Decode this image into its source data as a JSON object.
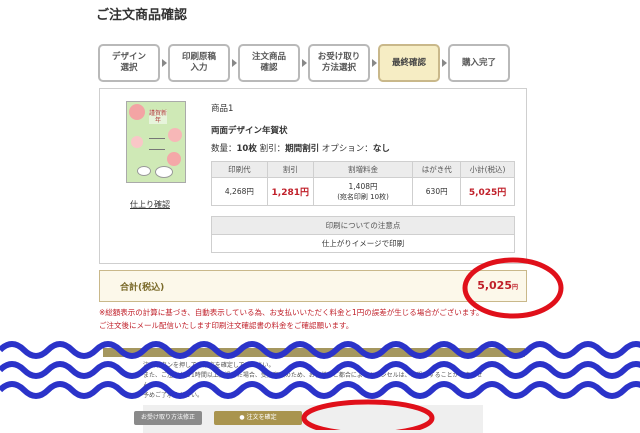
{
  "page_title": "ご注文商品確認",
  "steps": [
    {
      "label": "デザイン\n選択",
      "active": false
    },
    {
      "label": "印刷原稿\n入力",
      "active": false
    },
    {
      "label": "注文商品\n確認",
      "active": false
    },
    {
      "label": "お受け取り\n方法選択",
      "active": false
    },
    {
      "label": "最終確認",
      "active": true
    },
    {
      "label": "購入完了",
      "active": false
    }
  ],
  "product": {
    "item_label": "商品1",
    "name": "両面デザイン年賀状",
    "thumbnail_text": "謹賀新年",
    "thumbnail_link": "仕上り確認",
    "qty_label": "数量：",
    "qty_value": "10枚",
    "discount_label": "割引：",
    "discount_value": "期間割引",
    "option_label": "オプション：",
    "option_value": "なし"
  },
  "price_table": {
    "headers": [
      "印刷代",
      "割引",
      "割増料金",
      "はがき代",
      "小計(税込)"
    ],
    "print_fee": "4,268円",
    "discount": "1,281円",
    "surcharge": "1,408円",
    "surcharge_note": "(宛名印刷 10枚)",
    "postcard_fee": "630円",
    "subtotal": "5,025円"
  },
  "notes_table": {
    "header": "印刷についての注意点",
    "value": "仕上がりイメージで印刷"
  },
  "total": {
    "label": "合計(税込)",
    "value": "5,025",
    "unit": "円"
  },
  "warnings": [
    "※総額表示の計算に基づき、自動表示している為、お支払いいただく料金と1円の誤差が生じる場合がございます。",
    "ご注文後にメール配信いたします印刷注文確認書の料金をご確認願います。"
  ],
  "panel_text": "注文ボタンを押してご注文を確定してください。\nまた、ご注文から1時間以上経過した場合、受注商品のため、お客様のご都合によるキャンセルは、お受けすることができません。\n予めご了承ください。",
  "buttons": {
    "back": "お受け取り方法修正",
    "confirm": "注文を確定"
  },
  "colors": {
    "accent_red": "#c0202a",
    "step_active": "#f6edc4",
    "total_border": "#c9b88a",
    "annotation_red": "#e0101a",
    "annotation_blue": "#2b33c9"
  }
}
